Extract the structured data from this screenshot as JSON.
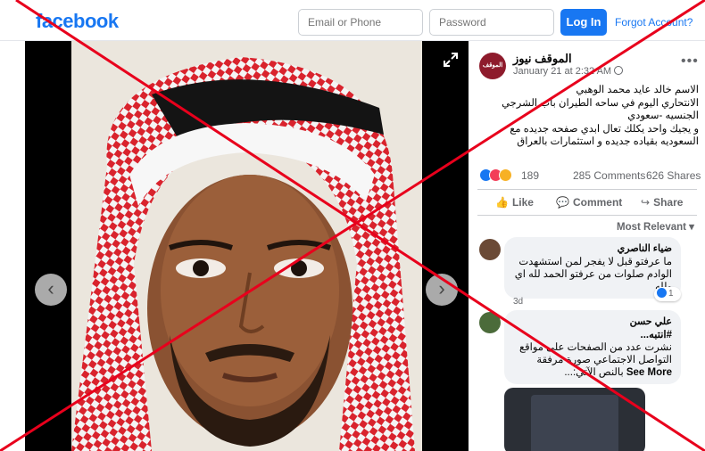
{
  "topbar": {
    "logo": "facebook",
    "email_placeholder": "Email or Phone",
    "password_placeholder": "Password",
    "login_label": "Log In",
    "forgot_label": "Forgot Account?"
  },
  "viewer": {
    "prev_icon": "‹",
    "next_icon": "›"
  },
  "post": {
    "page_name": "الموقف نيوز",
    "avatar_text": "الموقف",
    "date": "January 21 at 2:32 AM",
    "more_icon": "•••",
    "text_lines": [
      "الاسم خالد عايد محمد الوهبي",
      "الانتحاري اليوم في ساحه الطيران باب الشرجي",
      "الجنسيه -سعودي",
      "و يجيك واحد يكلك تعال ابدي صفحه جديده مع",
      "السعوديه بقياده جديده و استثمارات بالعراق"
    ],
    "reaction_count": "189",
    "comments": "285 Comments",
    "shares": "626 Shares",
    "actions": {
      "like": "Like",
      "comment": "Comment",
      "share": "Share"
    },
    "sort_label": "Most Relevant ▾"
  },
  "comments": [
    {
      "name": "ضياء الناصري",
      "lines": [
        "ما عرفتو قبل لا يفجر لمن استشهدت",
        "الوادم صلوات من عرفتو الحمد لله اي",
        "ولله"
      ],
      "age": "3d",
      "reactions": "1"
    },
    {
      "name": "علي حسن",
      "lines": [
        "#انتبه...",
        "نشرت عدد من الصفحات على مواقع",
        "التواصل الاجتماعي صورة مرفقة",
        "بالنص الآتي:..."
      ],
      "see_more": "See More"
    }
  ],
  "colors": {
    "brand": "#1877f2",
    "cross": "#e8001c"
  }
}
